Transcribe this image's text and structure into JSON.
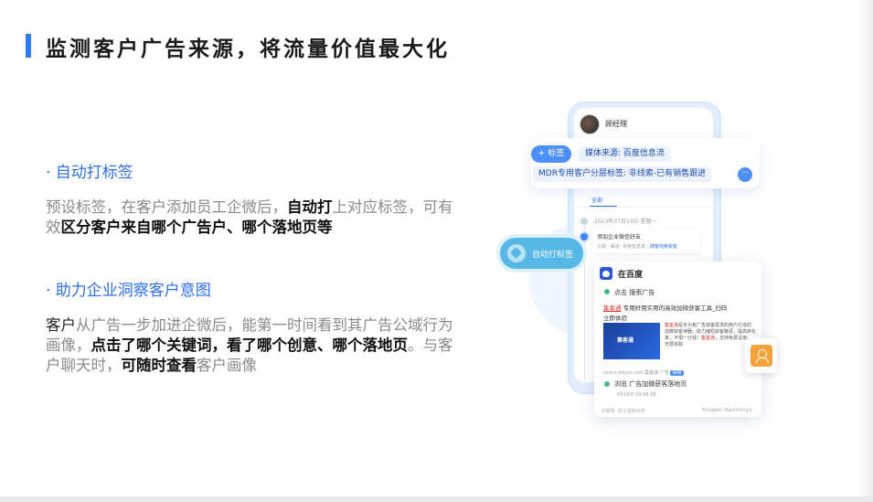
{
  "page": {
    "title": "监测客户广告来源，将流量价值最大化"
  },
  "sections": [
    {
      "heading": "· 自动打标签",
      "body": {
        "p1": "预设标签，在客户添加员工企微后，",
        "b1": "自动打",
        "p2": "上对应标签，可有效",
        "b2": "区分客户来自哪个广告户、哪个落地页等"
      }
    },
    {
      "heading": "· 助力企业洞察客户意图",
      "body": {
        "d1": "客户",
        "p1": "从广告一步加进企微后，能第一时间看到其广告公域行为画像，",
        "b1": "点击了哪个关键词，看了哪个创意、哪个落地页",
        "p2": "。与客户聊天时，",
        "b2": "可随时查看",
        "p3": "客户画像"
      }
    }
  ],
  "mockup": {
    "contact_name": "顾经理",
    "add_tag_label": "+ 标签",
    "tag_media": "媒体来源: 百度信息流",
    "tag_mdr": "MDR专用客户分层标签: 非线索-已有销售跟进",
    "more_label": "···",
    "filter_all": "全部",
    "timeline_date": "2023年07月10日 星期一",
    "event_title": "添加企业微信好友",
    "event_meta_a": "小顾 · 渠道: 百度信息流 · ",
    "event_meta_link": "搜客线索获客",
    "auto_tag_label": "自动打标签",
    "baidu_title": "在百度",
    "click_label": "点击  搜索广告",
    "ad_brand": "集客通",
    "ad_line1_rest": " 专用好用实用的高效加微获客工具_扫码",
    "ad_line2": "立即体验",
    "ad_image_text": "集客通",
    "ad_desc_brand": "集客通",
    "ad_desc_rest": "是专为有广告获客需求的用户打造的加微获客神器，助力缩短获客路径，提高转化率，不惧一分钱！",
    "ad_desc_brand2": "集客通",
    "ad_desc_end": "，支持免费试用，无限追踪",
    "ad_source": "xxxcn.aliyun.com 集客通 广告 ",
    "ad_badge": "保障",
    "browse_label": "浏览  广告加微获客落地页",
    "browse_time": "7月10日 09:56:38",
    "footer_left": "IP属地: 浙江省杭州市",
    "footer_right": "Huawei Harmonys",
    "colors": {
      "accent": "#2d7cf6",
      "heading_blue": "#2f6fe8",
      "pill_blue": "#57b7e6",
      "brand_red": "#d2362d",
      "contact_orange": "#f6a13a",
      "status_green": "#3fbf7f"
    },
    "icons": [
      "shield-tag-icon",
      "baidu-icon",
      "contact-card-icon"
    ]
  }
}
